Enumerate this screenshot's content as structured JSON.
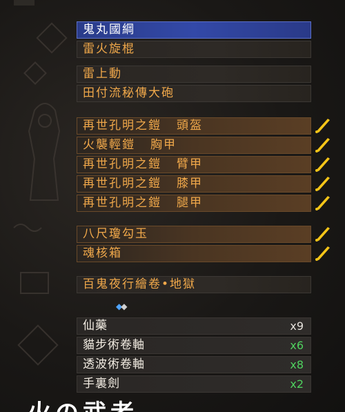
{
  "weapons": [
    "鬼丸國綱",
    "雷火旋棍"
  ],
  "ranged": [
    "雷上動",
    "田付流秘傳大砲"
  ],
  "armor": [
    {
      "set": "再世孔明之鎧",
      "part": "頭盔"
    },
    {
      "set": "火襲輕鎧",
      "part": "胸甲"
    },
    {
      "set": "再世孔明之鎧",
      "part": "臂甲"
    },
    {
      "set": "再世孔明之鎧",
      "part": "膝甲"
    },
    {
      "set": "再世孔明之鎧",
      "part": "腿甲"
    }
  ],
  "accessories": [
    "八尺瓊勾玉",
    "魂核箱"
  ],
  "guardian_scroll": "百鬼夜行繪卷•地獄",
  "items": [
    {
      "name": "仙藥",
      "count": "x9"
    },
    {
      "name": "貓步術卷軸",
      "count": "x6"
    },
    {
      "name": "透波術卷軸",
      "count": "x8"
    },
    {
      "name": "手裏劍",
      "count": "x2"
    }
  ],
  "bottom_overlay": "火の武者",
  "colors": {
    "selected": "#3349a8",
    "text_orange": "#f0a84a",
    "count_green": "#4fd25f",
    "quill_yellow": "#f5c518"
  },
  "icons": {
    "upgrade": "quill-icon",
    "slot_gems": "gem-icon"
  }
}
